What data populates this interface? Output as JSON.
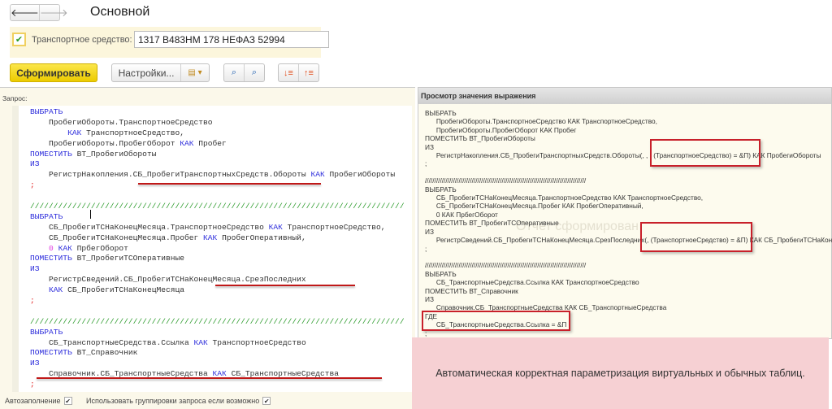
{
  "nav": {
    "back": "🡐",
    "forward": "🡒"
  },
  "title": "Основной",
  "param": {
    "label": "Транспортное средство:",
    "value": "1317  В483НМ 178 НЕФАЗ 52994",
    "checked": true
  },
  "toolbar": {
    "generate": "Сформировать",
    "settings": "Настройки...",
    "search_icon": "🔍"
  },
  "query_label": "Запрос:",
  "code_lines": [
    [
      [
        "kw",
        "ВЫБРАТЬ"
      ]
    ],
    [
      [
        "",
        "    ПробегиОбороты.ТранспортноеСредство"
      ]
    ],
    [
      [
        "",
        "        "
      ],
      [
        "kw",
        "КАК"
      ],
      [
        "",
        " ТранспортноеСредство,"
      ]
    ],
    [
      [
        "",
        "    ПробегиОбороты.ПробегОборот "
      ],
      [
        "kw",
        "КАК"
      ],
      [
        "",
        " Пробег"
      ]
    ],
    [
      [
        "kw",
        "ПОМЕСТИТЬ"
      ],
      [
        "",
        " ВТ_ПробегиОбороты"
      ]
    ],
    [
      [
        "kw",
        "ИЗ"
      ]
    ],
    [
      [
        "",
        "    РегистрНакопления.СБ_ПробегиТранспортныхСредств.Обороты "
      ],
      [
        "kw",
        "КАК"
      ],
      [
        "",
        " ПробегиОбороты"
      ]
    ],
    [
      [
        "semi",
        ";"
      ]
    ],
    [
      [
        "",
        ""
      ]
    ],
    [
      [
        "cm",
        "////////////////////////////////////////////////////////////////////////////////"
      ]
    ],
    [
      [
        "kw",
        "ВЫБРАТЬ"
      ]
    ],
    [
      [
        "",
        "    СБ_ПробегиТСНаКонецМесяца.ТранспортноеСредство "
      ],
      [
        "kw",
        "КАК"
      ],
      [
        "",
        " ТранспортноеСредство,"
      ]
    ],
    [
      [
        "",
        "    СБ_ПробегиТСНаКонецМесяца.Пробег "
      ],
      [
        "kw",
        "КАК"
      ],
      [
        "",
        " ПробегОперативный,"
      ]
    ],
    [
      [
        "",
        "    "
      ],
      [
        "num",
        "0"
      ],
      [
        "",
        " "
      ],
      [
        "kw",
        "КАК"
      ],
      [
        "",
        " ПрбегОборот"
      ]
    ],
    [
      [
        "kw",
        "ПОМЕСТИТЬ"
      ],
      [
        "",
        " ВТ_ПробегиТСОперативные"
      ]
    ],
    [
      [
        "kw",
        "ИЗ"
      ]
    ],
    [
      [
        "",
        "    РегистрСведений.СБ_ПробегиТСНаКонецМесяца.СрезПоследних"
      ]
    ],
    [
      [
        "",
        "    "
      ],
      [
        "kw",
        "КАК"
      ],
      [
        "",
        " СБ_ПробегиТСНаКонецМесяца"
      ]
    ],
    [
      [
        "semi",
        ";"
      ]
    ],
    [
      [
        "",
        ""
      ]
    ],
    [
      [
        "cm",
        "////////////////////////////////////////////////////////////////////////////////"
      ]
    ],
    [
      [
        "kw",
        "ВЫБРАТЬ"
      ]
    ],
    [
      [
        "",
        "    СБ_ТранспортныеСредства.Ссылка "
      ],
      [
        "kw",
        "КАК"
      ],
      [
        "",
        " ТранспортноеСредство"
      ]
    ],
    [
      [
        "kw",
        "ПОМЕСТИТЬ"
      ],
      [
        "",
        " ВТ_Справочник"
      ]
    ],
    [
      [
        "kw",
        "ИЗ"
      ]
    ],
    [
      [
        "",
        "    Справочник.СБ_ТранспортныеСредства "
      ],
      [
        "kw",
        "КАК"
      ],
      [
        "",
        " СБ_ТранспортныеСредства"
      ]
    ],
    [
      [
        "semi",
        ";"
      ]
    ]
  ],
  "options": {
    "autofill": "Автозаполнение",
    "use_groups": "Использовать группировки запроса если возможно"
  },
  "preview": {
    "title": "Просмотр значения выражения",
    "text": "ВЫБРАТЬ\n      ПробегиОбороты.ТранспортноеСредство КАК ТранспортноеСредство,\n      ПробегиОбороты.ПробегОборот КАК Пробег\nПОМЕСТИТЬ ВТ_ПробегиОбороты\nИЗ\n      РегистрНакопления.СБ_ПробегиТранспортныхСредств.Обороты(, , , (ТранспортноеСредство) = &П) КАК ПробегиОбороты\n;\n\n//////////////////////////////////////////////////////////////////////////////////////\nВЫБРАТЬ\n      СБ_ПробегиТСНаКонецМесяца.ТранспортноеСредство КАК ТранспортноеСредство,\n      СБ_ПробегиТСНаКонецМесяца.Пробег КАК ПробегОперативный,\n      0 КАК ПрбегОборот\nПОМЕСТИТЬ ВТ_ПробегиТСОперативные\nИЗ\n      РегистрСведений.СБ_ПробегиТСНаКонецМесяца.СрезПоследних(, (ТранспортноеСредство) = &П) КАК СБ_ПробегиТСНаКонецМесяца\n;\n\n//////////////////////////////////////////////////////////////////////////////////////\nВЫБРАТЬ\n      СБ_ТранспортныеСредства.Ссылка КАК ТранспортноеСредство\nПОМЕСТИТЬ ВТ_Справочник\nИЗ\n      Справочник.СБ_ТранспортныеСредства КАК СБ_ТранспортныеСредства\nГДЕ\n      СБ_ТранспортныеСредства.Ссылка = &П\n;",
    "faded_bg": "Отчет сформирован"
  },
  "caption": "Автоматическая корректная параметризация виртуальных и обычных таблиц."
}
